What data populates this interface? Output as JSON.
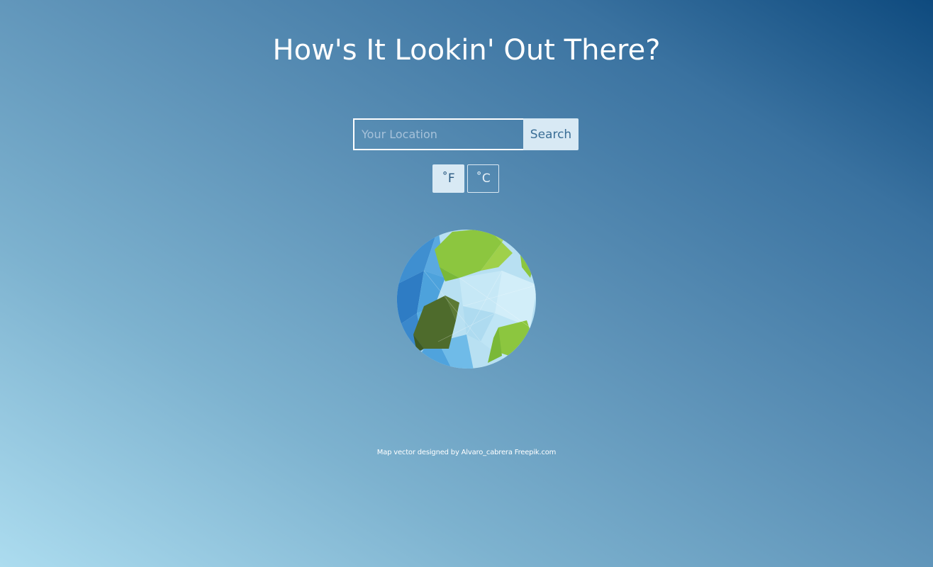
{
  "header": {
    "title": "How's It Lookin' Out There?"
  },
  "search": {
    "placeholder": "Your Location",
    "value": "",
    "button_label": "Search"
  },
  "units": {
    "fahrenheit_label": "˚F",
    "celsius_label": "˚C",
    "selected": "fahrenheit"
  },
  "globe": {
    "icon": "globe-icon"
  },
  "footer": {
    "credit": "Map vector designed by Alvaro_cabrera Freepik.com"
  },
  "colors": {
    "bg_light": "#acdcef",
    "bg_dark": "#0e4a7e",
    "button_bg": "#d8e9f4",
    "land_green": "#8cc63f",
    "land_dark": "#4e6b2c",
    "ocean_light": "#b8e0f2",
    "ocean_blue": "#4a9fd8"
  }
}
